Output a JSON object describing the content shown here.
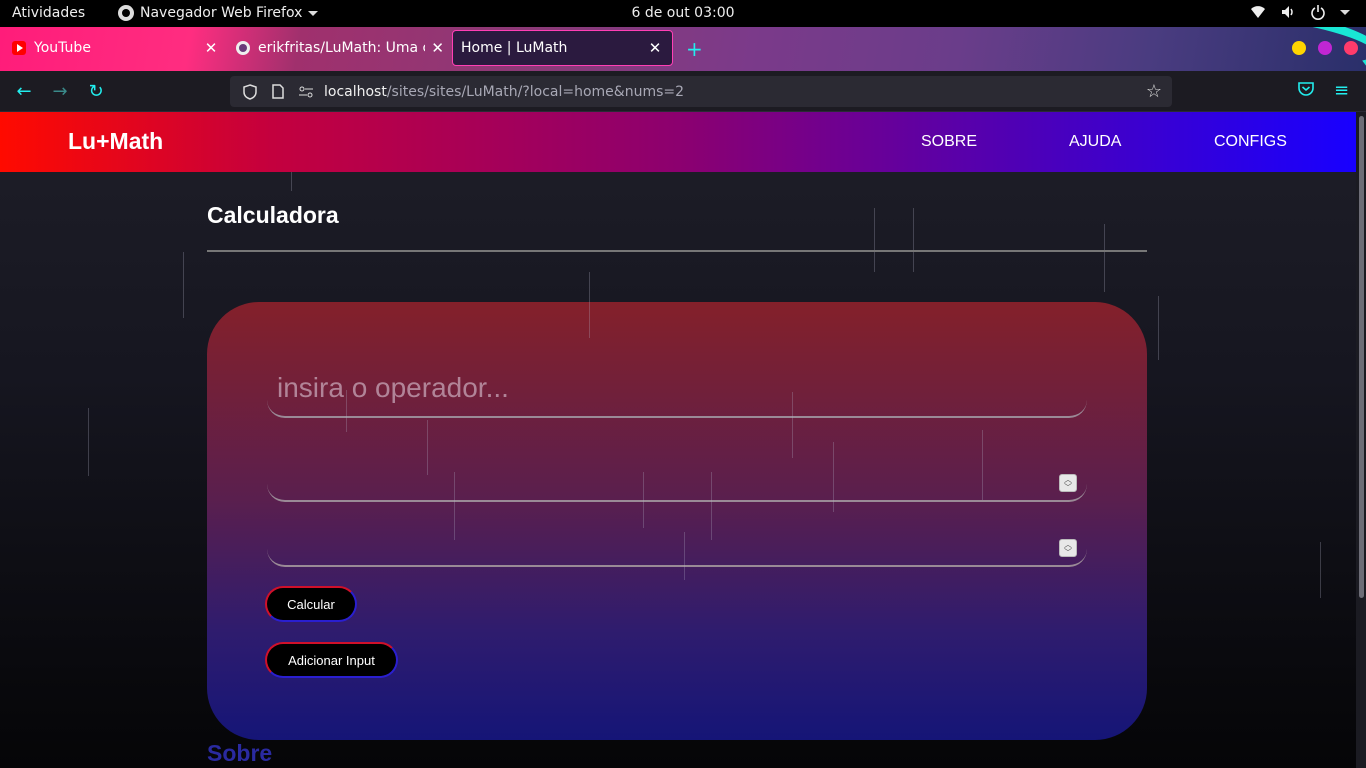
{
  "system_bar": {
    "activities": "Atividades",
    "app_name": "Navegador Web Firefox",
    "clock": "6 de out  03:00"
  },
  "browser": {
    "tabs": [
      {
        "title": "YouTube",
        "icon": "youtube-icon",
        "active": false
      },
      {
        "title": "erikfritas/LuMath: Uma calculadora",
        "icon": "github-icon",
        "active": false
      },
      {
        "title": "Home | LuMath",
        "icon": "none",
        "active": true
      }
    ],
    "url": {
      "host": "localhost",
      "path": "/sites/sites/LuMath/?local=home&nums=2"
    },
    "theme_colors": {
      "accent": "#19e7d5",
      "tab_gradient_start": "#ff1c7a",
      "window_dots": [
        "#ffd500",
        "#c026d3",
        "#ff3b6b"
      ]
    }
  },
  "site": {
    "logo": "Lu+Math",
    "nav": [
      "SOBRE",
      "AJUDA",
      "CONFIGS"
    ],
    "header_gradient": [
      "#ff0a00",
      "#8c006f",
      "#1800ff"
    ]
  },
  "calculator": {
    "title": "Calculadora",
    "operator_placeholder": "insira o operador...",
    "number_inputs": [
      {
        "value": ""
      },
      {
        "value": ""
      }
    ],
    "buttons": {
      "calculate": "Calcular",
      "add_input": "Adicionar Input"
    }
  },
  "next_section": {
    "title": "Sobre"
  }
}
